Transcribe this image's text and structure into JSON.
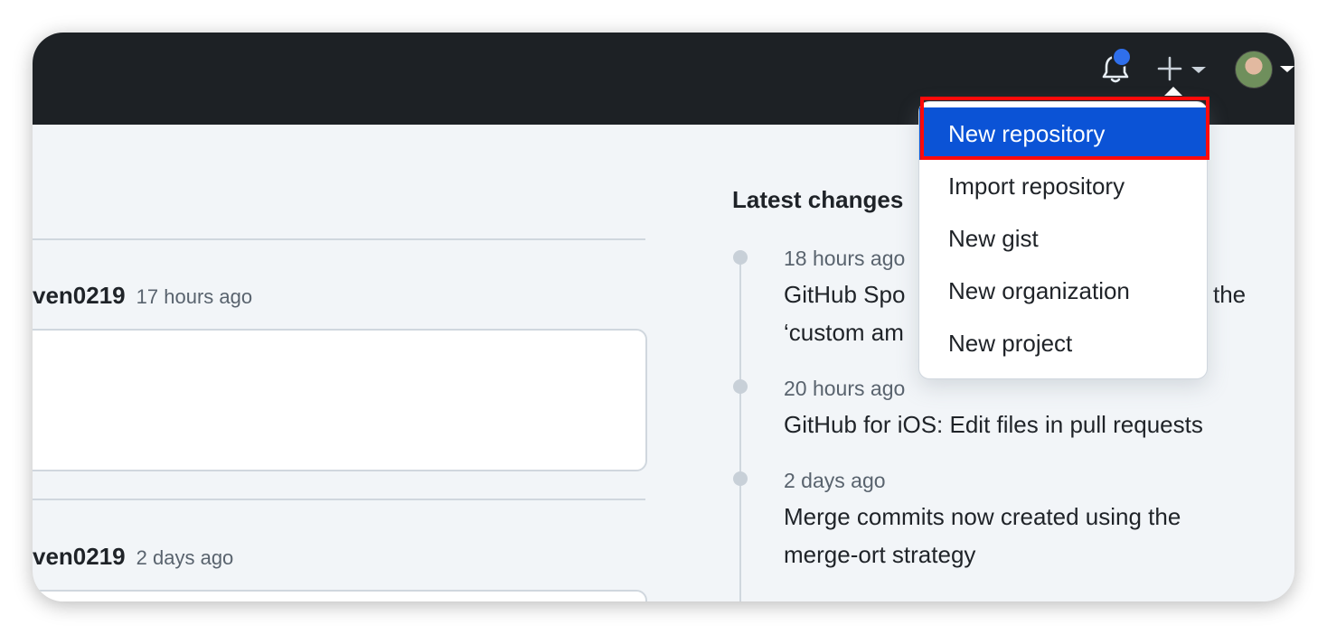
{
  "header": {
    "notifications_icon": "bell-icon",
    "create_icon": "plus-icon",
    "create_caret_icon": "caret-down-icon",
    "avatar_icon": "user-avatar"
  },
  "feed": {
    "items": [
      {
        "user": "ven0219",
        "time": "17 hours ago"
      },
      {
        "user": "ven0219",
        "time": "2 days ago"
      }
    ]
  },
  "latest_changes": {
    "title": "Latest changes",
    "items": [
      {
        "time": "18 hours ago",
        "title_line1": "GitHub Spo",
        "title_line1_end": "the",
        "title_line2": "‘custom am"
      },
      {
        "time": "20 hours ago",
        "title_line1": "GitHub for iOS: Edit files in pull requests"
      },
      {
        "time": "2 days ago",
        "title_line1": "Merge commits now created using the",
        "title_line2": "merge-ort strategy"
      }
    ]
  },
  "create_menu": {
    "items": [
      "New repository",
      "Import repository",
      "New gist",
      "New organization",
      "New project"
    ],
    "active_index": 0
  },
  "colors": {
    "header_bg": "#1d2125",
    "page_bg": "#f2f5f8",
    "accent": "#0b53d6",
    "notification_dot": "#2f6feb",
    "highlight_outline": "#ff0a0a"
  }
}
